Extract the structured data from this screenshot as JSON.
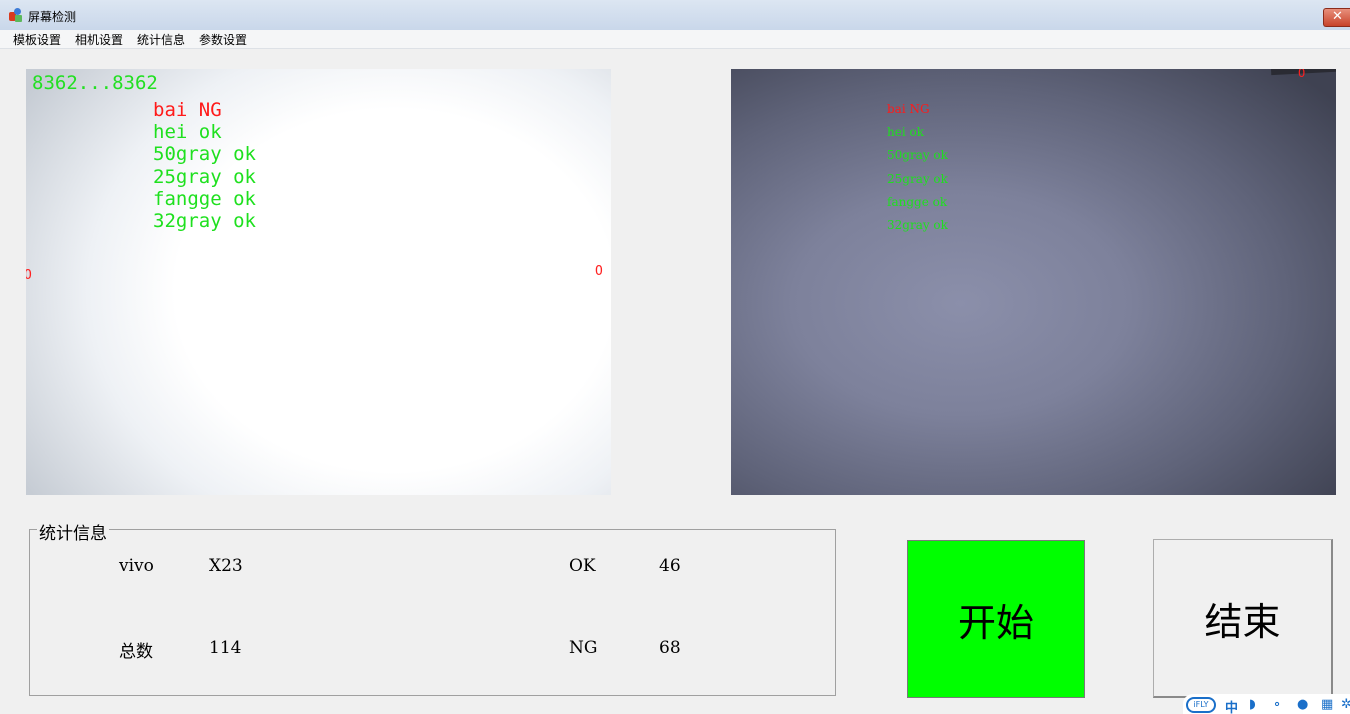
{
  "window": {
    "title": "屏幕检测",
    "close_glyph": "✕"
  },
  "menu": {
    "items": [
      "模板设置",
      "相机设置",
      "统计信息",
      "参数设置"
    ]
  },
  "left_view": {
    "counter": "8362...8362",
    "results": [
      {
        "text": "bai NG",
        "status": "NG",
        "color": "#ff1a1a"
      },
      {
        "text": "hei ok",
        "status": "ok",
        "color": "#1ee01e"
      },
      {
        "text": "50gray ok",
        "status": "ok",
        "color": "#1ee01e"
      },
      {
        "text": "25gray ok",
        "status": "ok",
        "color": "#1ee01e"
      },
      {
        "text": "fangge ok",
        "status": "ok",
        "color": "#1ee01e"
      },
      {
        "text": "32gray ok",
        "status": "ok",
        "color": "#1ee01e"
      }
    ],
    "marker_left": "O",
    "marker_right": "O"
  },
  "right_view": {
    "results": [
      {
        "text": "bai NG",
        "status": "NG"
      },
      {
        "text": "hei ok",
        "status": "ok"
      },
      {
        "text": "50gray ok",
        "status": "ok"
      },
      {
        "text": "25gray ok",
        "status": "ok"
      },
      {
        "text": "fangge ok",
        "status": "ok"
      },
      {
        "text": "32gray ok",
        "status": "ok"
      }
    ],
    "marker": "O"
  },
  "stats": {
    "legend": "统计信息",
    "brand": "vivo",
    "model": "X23",
    "ok_label": "OK",
    "ok_count": "46",
    "total_label": "总数",
    "total_count": "114",
    "ng_label": "NG",
    "ng_count": "68"
  },
  "buttons": {
    "start": "开始",
    "end": "结束",
    "start_color": "#00ff00"
  },
  "ime": {
    "logo": "iFLY",
    "mode": "中"
  }
}
